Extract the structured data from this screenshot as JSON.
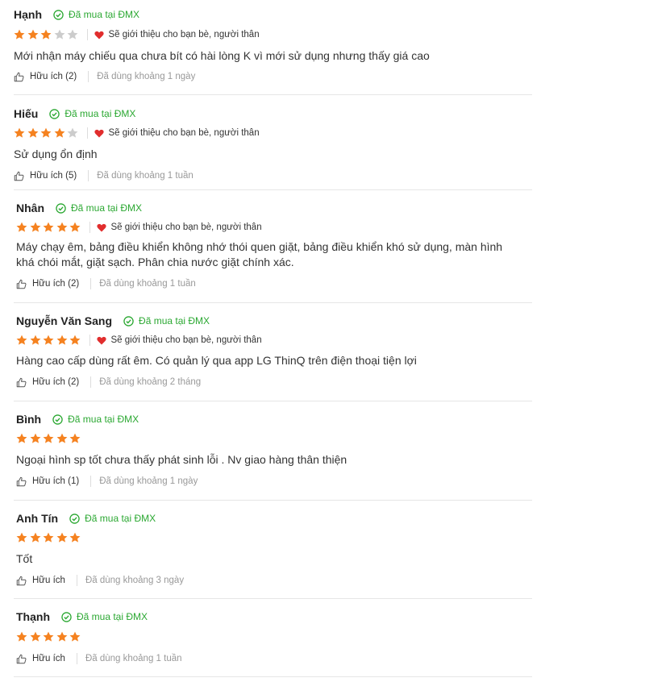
{
  "colors": {
    "star_on": "#f58220",
    "star_off": "#cccccc",
    "verified": "#2ba832",
    "heart": "#e12d2d"
  },
  "icons": {
    "verified": "check-circle-icon",
    "recommend": "heart-icon",
    "helpful": "thumbs-up-icon",
    "rating": "star-icon"
  },
  "reviews": [
    {
      "name": "Hạnh",
      "verified": "Đã mua tại ĐMX",
      "rating": 3,
      "recommend": "Sẽ giới thiệu cho bạn bè, người thân",
      "content": "Mới nhận máy chiếu qua chưa bít có hài lòng K vì mới sử dụng nhưng thấy giá cao",
      "helpful": "Hữu ích (2)",
      "used": "Đã dùng khoảng 1 ngày"
    },
    {
      "name": "Hiếu",
      "verified": "Đã mua tại ĐMX",
      "rating": 4,
      "recommend": "Sẽ giới thiệu cho bạn bè, người thân",
      "content": "Sử dụng ổn định",
      "helpful": "Hữu ích (5)",
      "used": "Đã dùng khoảng 1 tuần"
    },
    {
      "name": "Nhân",
      "verified": "Đã mua tại ĐMX",
      "rating": 5,
      "recommend": "Sẽ giới thiệu cho bạn bè, người thân",
      "content": "Máy chạy êm, bảng điều khiển không nhớ thói quen giặt, bảng điều khiển khó sử dụng, màn hình khá chói mắt, giặt sạch. Phân chia nước giặt chính xác.",
      "helpful": "Hữu ích (2)",
      "used": "Đã dùng khoảng 1 tuần"
    },
    {
      "name": "Nguyễn Văn Sang",
      "verified": "Đã mua tại ĐMX",
      "rating": 5,
      "recommend": "Sẽ giới thiệu cho bạn bè, người thân",
      "content": "Hàng cao cấp dùng rất êm. Có quản lý qua app LG ThinQ trên điện thoại tiện lợi",
      "helpful": "Hữu ích (2)",
      "used": "Đã dùng khoảng 2 tháng"
    },
    {
      "name": "Bình",
      "verified": "Đã mua tại ĐMX",
      "rating": 5,
      "recommend": "",
      "content": "Ngoại hình sp tốt chưa thấy phát sinh lỗi . Nv giao hàng thân thiện",
      "helpful": "Hữu ích (1)",
      "used": "Đã dùng khoảng 1 ngày"
    },
    {
      "name": "Anh Tín",
      "verified": "Đã mua tại ĐMX",
      "rating": 5,
      "recommend": "",
      "content": "Tốt",
      "helpful": "Hữu ích",
      "used": "Đã dùng khoảng 3 ngày"
    },
    {
      "name": "Thạnh",
      "verified": "Đã mua tại ĐMX",
      "rating": 5,
      "recommend": "",
      "content": "",
      "helpful": "Hữu ích",
      "used": "Đã dùng khoảng 1 tuần"
    }
  ]
}
